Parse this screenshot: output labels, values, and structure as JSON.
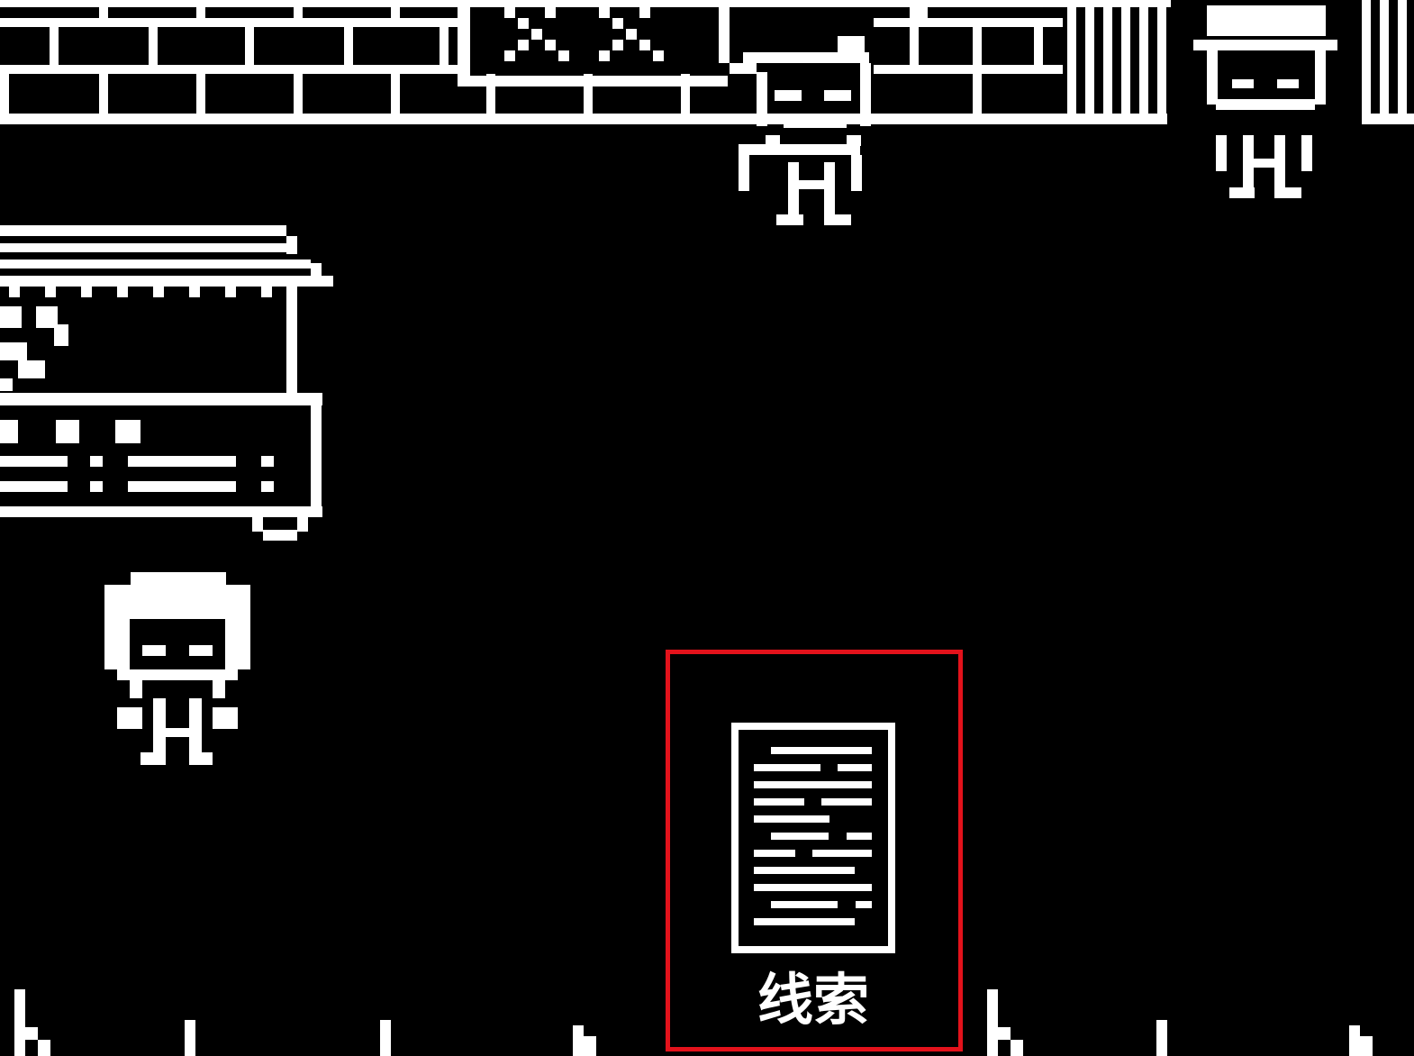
{
  "game": {
    "clue_button": {
      "label": "线索",
      "icon": "document-icon",
      "highlight_color": "#e3121b"
    },
    "colors": {
      "background": "#000000",
      "foreground": "#ffffff"
    }
  }
}
